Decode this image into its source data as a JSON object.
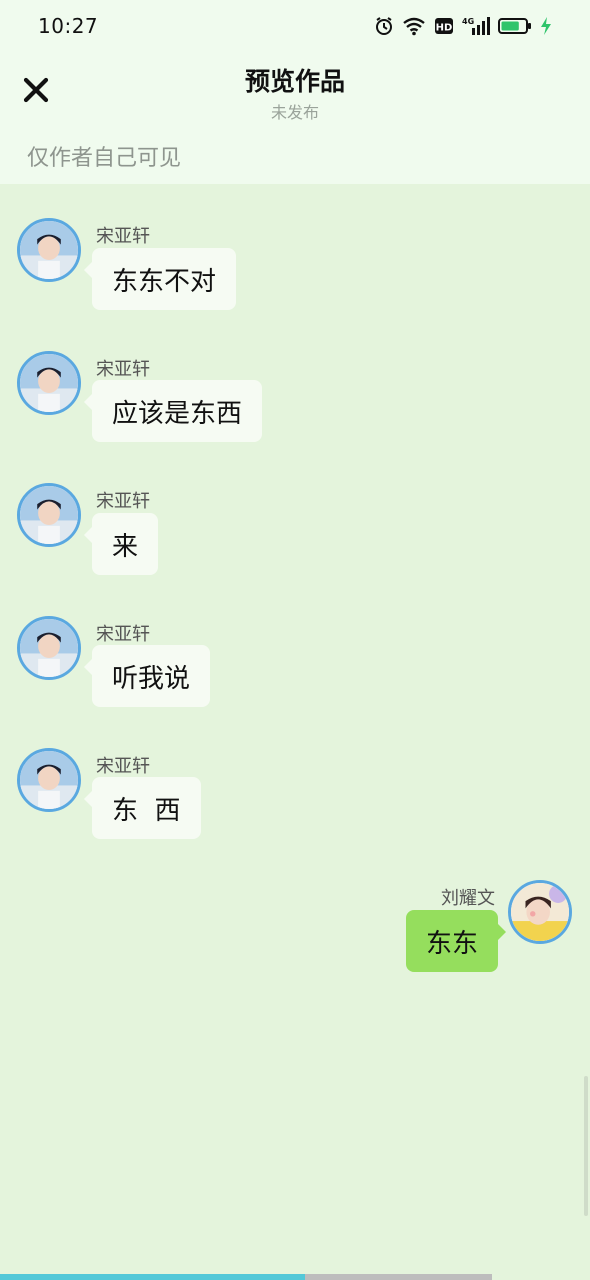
{
  "status_bar": {
    "time": "10:27",
    "icons": [
      "alarm-icon",
      "wifi-icon",
      "hd-icon",
      "signal-4g-icon",
      "battery-icon",
      "charging-icon"
    ],
    "hd_label": "HD",
    "network_label": "4G",
    "battery_level": 0.75
  },
  "header": {
    "title": "预览作品",
    "subtitle": "未发布",
    "visibility_note": "仅作者自己可见",
    "close_icon": "close-icon"
  },
  "messages": [
    {
      "sender": "宋亚轩",
      "text": "东东不对",
      "side": "left"
    },
    {
      "sender": "宋亚轩",
      "text": "应该是东西",
      "side": "left"
    },
    {
      "sender": "宋亚轩",
      "text": "来",
      "side": "left"
    },
    {
      "sender": "宋亚轩",
      "text": "听我说",
      "side": "left"
    },
    {
      "sender": "宋亚轩",
      "text": "东  西",
      "side": "left"
    },
    {
      "sender": "刘耀文",
      "text": "东东",
      "side": "right"
    }
  ],
  "progress": {
    "fraction": 0.62
  },
  "colors": {
    "background": "#e4f4dc",
    "header_bg": "#f0fbee",
    "bubble_left": "#f6fbf3",
    "bubble_right": "#95de5d",
    "avatar_border": "#5aa8e0",
    "progress": "#53c8d8"
  }
}
